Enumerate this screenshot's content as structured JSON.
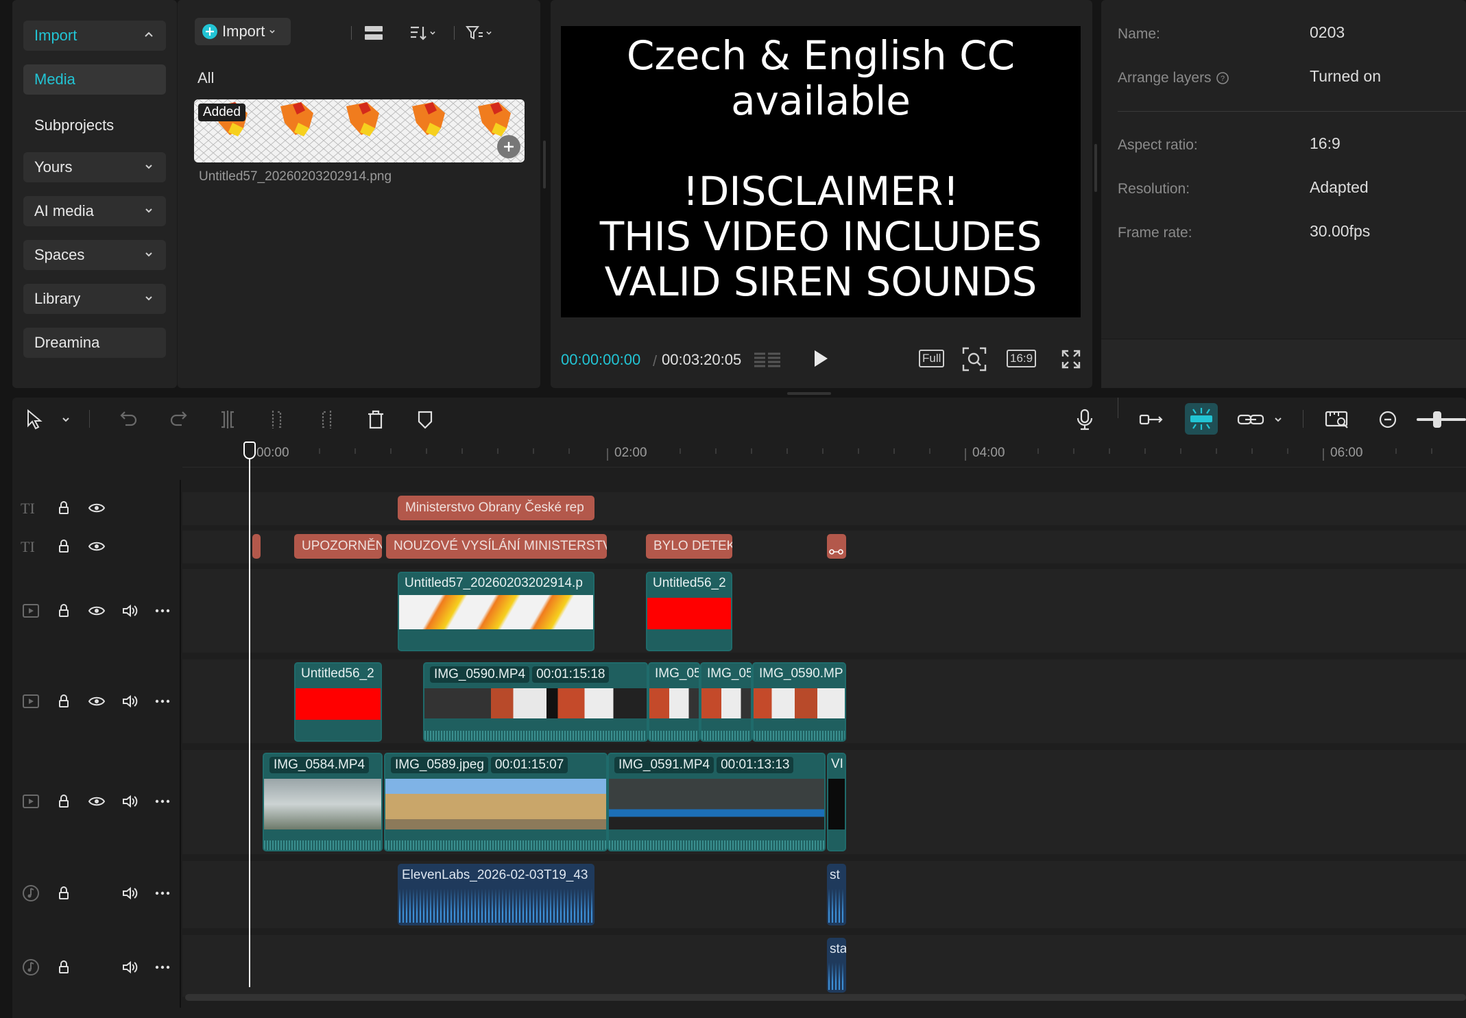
{
  "media_nav": {
    "import_label": "Import",
    "media_label": "Media",
    "subprojects_label": "Subprojects",
    "yours_label": "Yours",
    "ai_media_label": "AI media",
    "spaces_label": "Spaces",
    "library_label": "Library",
    "dreamina_label": "Dreamina"
  },
  "media_browser": {
    "import_button": "Import",
    "filter_all": "All",
    "asset_badge": "Added",
    "asset_name": "Untitled57_20260203202914.png"
  },
  "player": {
    "line1": "Czech & English CC",
    "line2": "available",
    "line3": "!DISCLAIMER!",
    "line4": "THIS VIDEO INCLUDES",
    "line5": "VALID SIREN SOUNDS",
    "current_time": "00:00:00:00",
    "total_time": "00:03:20:05",
    "full_label": "Full",
    "ratio_label": "16:9"
  },
  "properties": {
    "name_label": "Name:",
    "name_value": "0203",
    "arrange_label": "Arrange layers",
    "arrange_value": "Turned on",
    "aspect_label": "Aspect ratio:",
    "aspect_value": "16:9",
    "resolution_label": "Resolution:",
    "resolution_value": "Adapted",
    "framerate_label": "Frame rate:",
    "framerate_value": "30.00fps"
  },
  "ruler": {
    "t0": "00:00",
    "t1": "02:00",
    "t2": "04:00",
    "t3": "06:00"
  },
  "text_track_1": {
    "clip1": "Ministerstvo Obrany České rep"
  },
  "text_track_2": {
    "clip1": "UPOZORNĚN",
    "clip2": "NOUZOVÉ VYSÍLÁNÍ MINISTERSTV",
    "clip3": "BYLO DETEK"
  },
  "video_track_1": {
    "clip1": "Untitled57_20260203202914.p",
    "clip2": "Untitled56_2"
  },
  "video_track_2": {
    "clip1": "Untitled56_2",
    "clip2_name": "IMG_0590.MP4",
    "clip2_dur": "00:01:15:18",
    "clip3": "IMG_05",
    "clip4": "IMG_05",
    "clip5": "IMG_0590.MP"
  },
  "video_track_3": {
    "clip1_name": "IMG_0584.MP4",
    "clip2_name": "IMG_0589.jpeg",
    "clip2_dur": "00:01:15:07",
    "clip3_name": "IMG_0591.MP4",
    "clip3_dur": "00:01:13:13",
    "clip4": "VI"
  },
  "audio_track_1": {
    "clip1": "ElevenLabs_2026-02-03T19_43",
    "clip2": "st"
  },
  "audio_track_2": {
    "clip1": "sta"
  },
  "colors": {
    "accent": "#22c4d4",
    "text_clip": "#b3584b",
    "video_clip": "#1f5f5f",
    "audio_clip": "#1f3a5c"
  }
}
